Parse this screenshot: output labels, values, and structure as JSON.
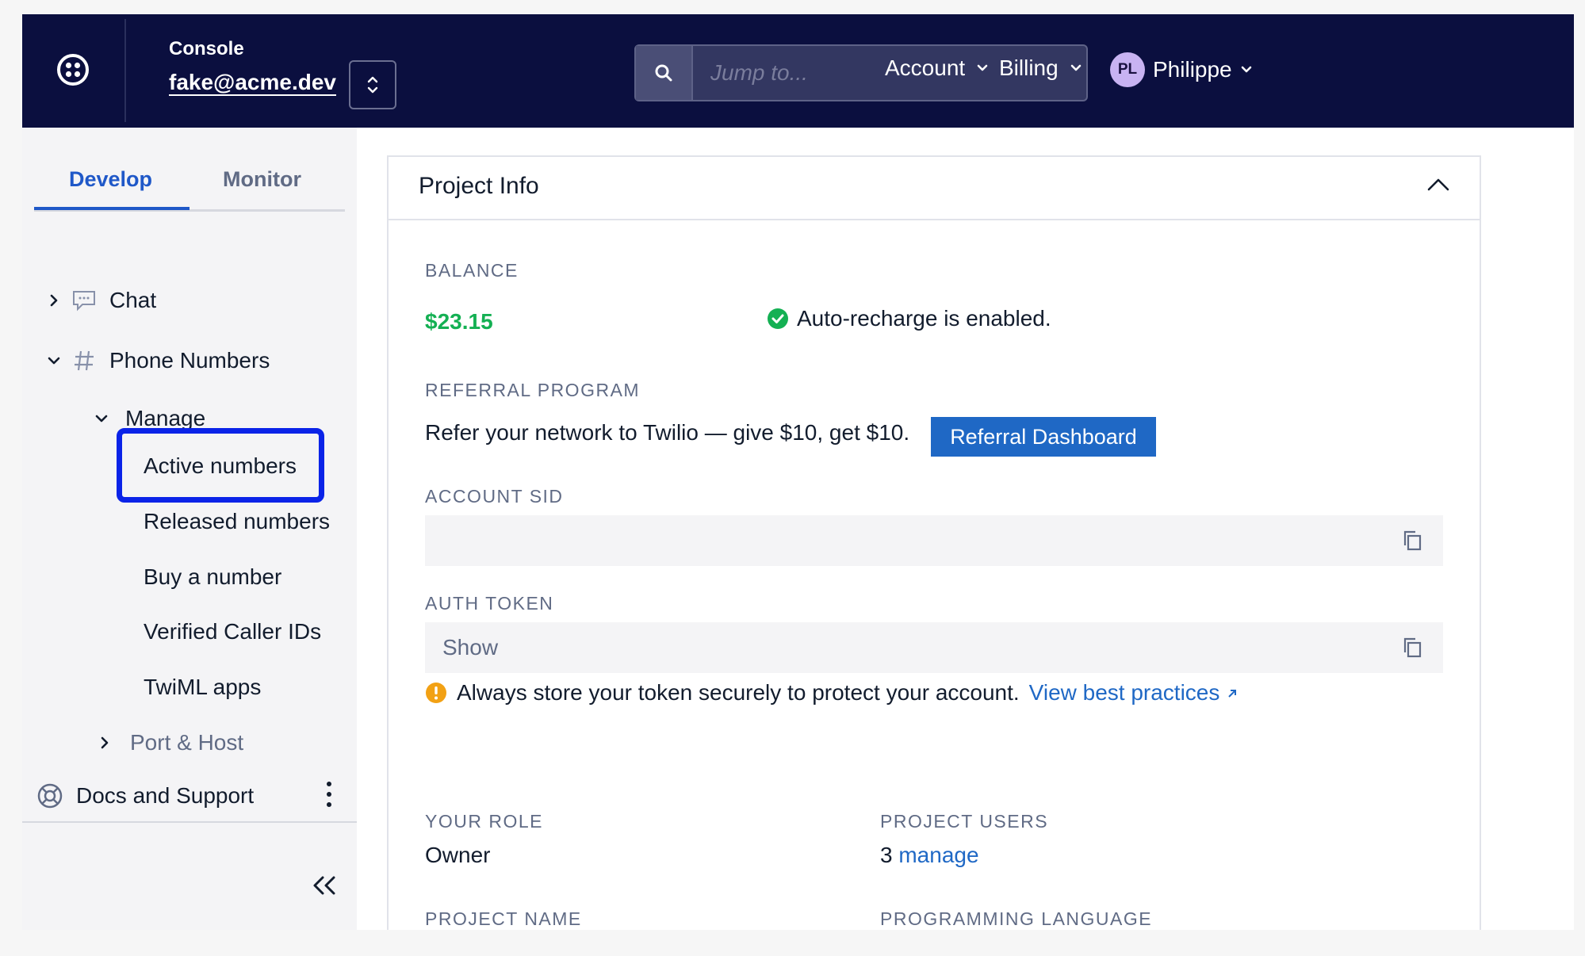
{
  "header": {
    "console_label": "Console",
    "account_email": "fake@acme.dev",
    "search_placeholder": "Jump to...",
    "nav": [
      {
        "label": "Account"
      },
      {
        "label": "Billing"
      }
    ],
    "user": {
      "initials": "PL",
      "name": "Philippe"
    },
    "colors": {
      "background": "#0b0f3f",
      "avatar": "#c8b3f2"
    }
  },
  "sidebar": {
    "tabs": [
      {
        "label": "Develop",
        "active": true
      },
      {
        "label": "Monitor",
        "active": false
      }
    ],
    "items": [
      {
        "label": "Chat",
        "icon": "chat-icon",
        "expanded": false
      },
      {
        "label": "Phone Numbers",
        "icon": "hash-icon",
        "expanded": true
      },
      {
        "label": "Manage",
        "expanded": true
      },
      {
        "label": "Active numbers",
        "highlighted": true
      },
      {
        "label": "Released numbers"
      },
      {
        "label": "Buy a number"
      },
      {
        "label": "Verified Caller IDs"
      },
      {
        "label": "TwiML apps"
      },
      {
        "label": "Port & Host",
        "expanded": false
      }
    ],
    "docs_support": "Docs and Support",
    "highlight_color": "#0a23e8"
  },
  "project_info": {
    "title": "Project Info",
    "balance_label": "BALANCE",
    "balance_value": "$23.15",
    "auto_recharge": "Auto-recharge is enabled.",
    "referral_label": "REFERRAL PROGRAM",
    "referral_text": "Refer your network to Twilio — give $10, get $10.",
    "referral_button": "Referral Dashboard",
    "account_sid_label": "ACCOUNT SID",
    "account_sid_value": "",
    "auth_token_label": "AUTH TOKEN",
    "auth_token_show": "Show",
    "token_warning": "Always store your token securely to protect your account.",
    "best_practices_link": "View best practices",
    "your_role_label": "YOUR ROLE",
    "your_role_value": "Owner",
    "project_users_label": "PROJECT USERS",
    "project_users_count": "3",
    "project_users_link": "manage",
    "project_name_label": "PROJECT NAME",
    "programming_language_label": "PROGRAMMING LANGUAGE",
    "colors": {
      "balance": "#14b053",
      "link": "#1f68c5",
      "success": "#14b053",
      "warning": "#f2a114"
    }
  }
}
